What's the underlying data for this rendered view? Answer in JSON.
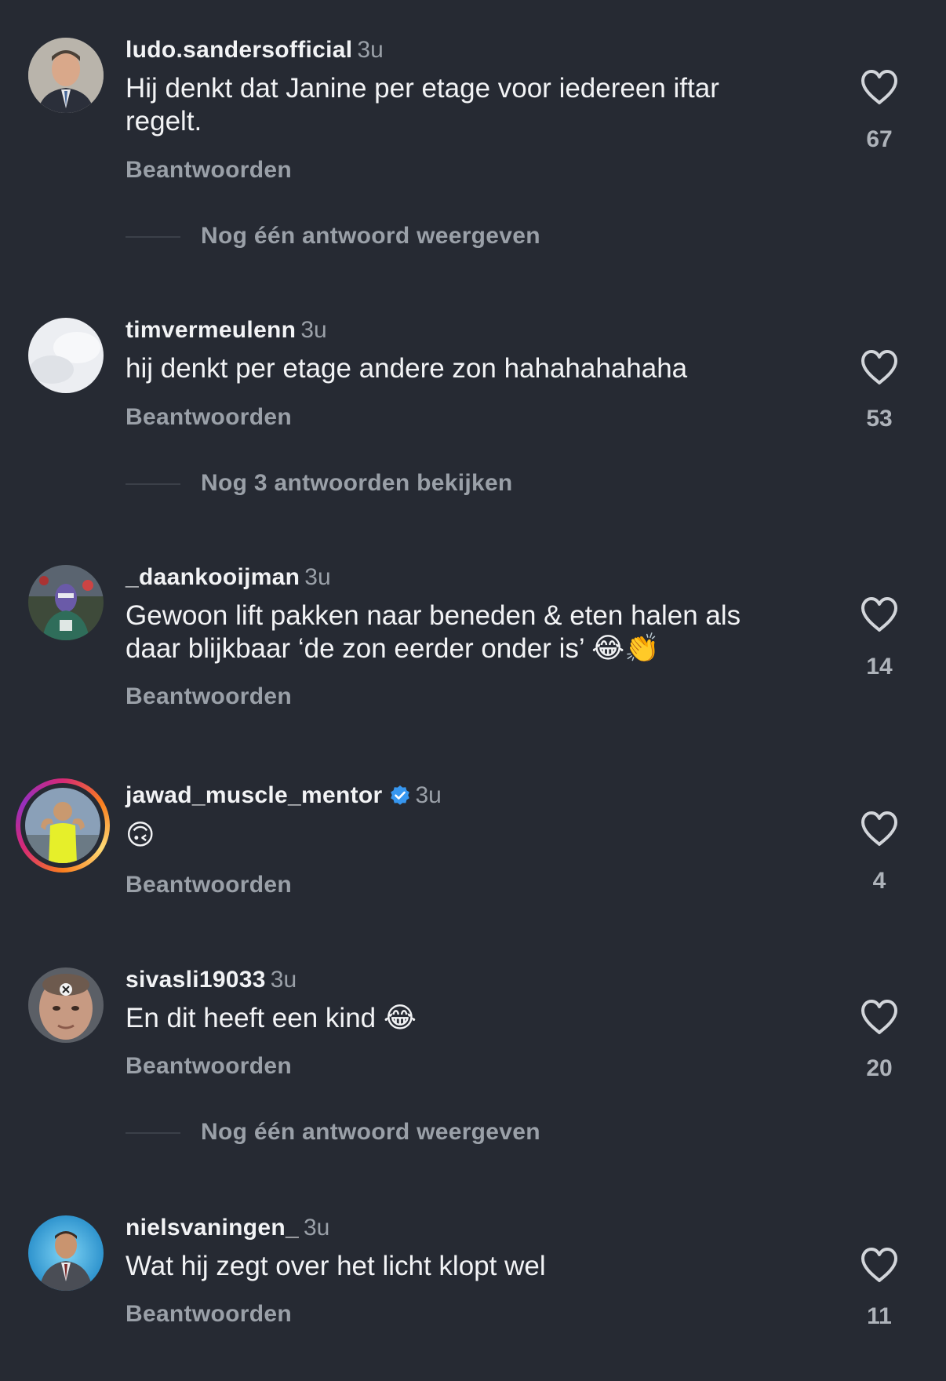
{
  "comments": [
    {
      "username": "ludo.sandersofficial",
      "time": "3u",
      "text": "Hij denkt dat Janine per etage voor iedereen iftar regelt.",
      "reply": "Beantwoorden",
      "likes": "67",
      "more_replies": "Nog één antwoord weergeven"
    },
    {
      "username": "timvermeulenn",
      "time": "3u",
      "text": "hij denkt per etage andere zon hahahahahaha",
      "reply": "Beantwoorden",
      "likes": "53",
      "more_replies": "Nog 3 antwoorden bekijken"
    },
    {
      "username": "_daankooijman",
      "time": "3u",
      "text": "Gewoon lift pakken naar beneden & eten halen als daar blijkbaar ‘de zon eerder onder is’",
      "emoji": "😂👏",
      "reply": "Beantwoorden",
      "likes": "14"
    },
    {
      "username": "jawad_muscle_mentor",
      "verified": true,
      "time": "3u",
      "text": "🙃",
      "reply": "Beantwoorden",
      "likes": "4"
    },
    {
      "username": "sivasli19033",
      "time": "3u",
      "text": "En dit heeft een kind",
      "emoji": "😂",
      "reply": "Beantwoorden",
      "likes": "20",
      "more_replies": "Nog één antwoord weergeven"
    },
    {
      "username": "nielsvaningen_",
      "time": "3u",
      "text": "Wat hij zegt over het licht klopt wel",
      "reply": "Beantwoorden",
      "likes": "11"
    }
  ],
  "icons": {
    "like": "heart-outline-icon",
    "verified": "verified-badge-icon"
  },
  "colors": {
    "background": "#262a33",
    "text": "#f2f3f5",
    "muted": "#9aa0a8",
    "verified": "#3797f0"
  }
}
